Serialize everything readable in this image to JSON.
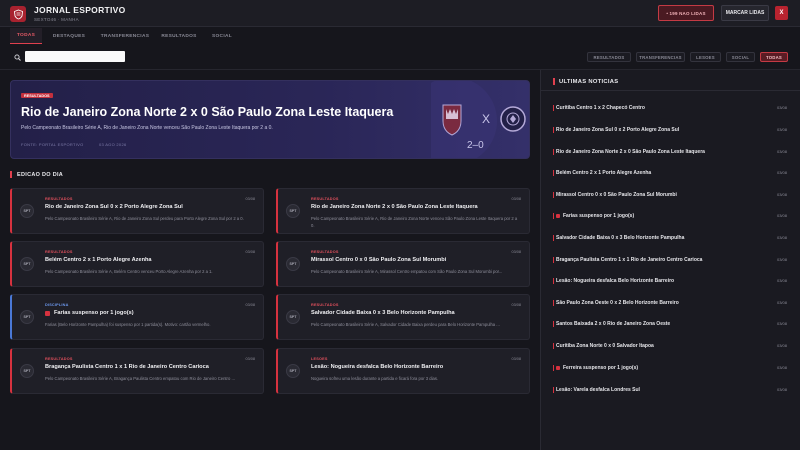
{
  "header": {
    "title": "JORNAL ESPORTIVO",
    "subtitle": "SEXTO46 · MANHA",
    "unread_label": "• 199 NAO LIDAS",
    "mark_read_label": "MARCAR LIDAS",
    "close_label": "X"
  },
  "tabs": [
    {
      "label": "TODAS",
      "active": true
    },
    {
      "label": "DESTAQUES",
      "active": false
    },
    {
      "label": "TRANSFERENCIAS",
      "active": false
    },
    {
      "label": "RESULTADOS",
      "active": false
    },
    {
      "label": "SOCIAL",
      "active": false
    }
  ],
  "search": {
    "value": "",
    "placeholder": ""
  },
  "filters": [
    {
      "label": "RESULTADOS",
      "active": false
    },
    {
      "label": "TRANSFERENCIAS",
      "active": false
    },
    {
      "label": "LESOES",
      "active": false
    },
    {
      "label": "SOCIAL",
      "active": false
    },
    {
      "label": "TODAS",
      "active": true
    }
  ],
  "hero": {
    "badge": "RESULTADOS",
    "title": "Rio de Janeiro Zona Norte 2 x 0 São Paulo Zona Leste Itaquera",
    "description": "Pelo Campeonato Brasileiro Série A, Rio de Janeiro Zona Norte venceu São Paulo Zona Leste Itaquera por 2 a 0.",
    "source": "FONTE: PORTAL ESPORTIVO",
    "date": "03 AGO 2026",
    "art_vs": "X",
    "art_score": "2–0"
  },
  "section": {
    "title": "EDICAO DO DIA"
  },
  "cards": [
    {
      "category": "RESULTADOS",
      "date": "03/08",
      "title": "Rio de Janeiro Zona Sul 0 x 2 Porto Alegre Zona Sul",
      "desc": "Pelo Campeonato Brasileiro Série A, Rio de Janeiro Zona Sul perdeu para Porto Alegre Zona Sul por 2 a 0.",
      "avatar": "SPT",
      "square": false,
      "color": "red"
    },
    {
      "category": "RESULTADOS",
      "date": "03/08",
      "title": "Rio de Janeiro Zona Norte 2 x 0 São Paulo Zona Leste Itaquera",
      "desc": "Pelo Campeonato Brasileiro Série A, Rio de Janeiro Zona Norte venceu São Paulo Zona Leste Itaquera por 2 a 0.",
      "avatar": "SPT",
      "square": false,
      "color": "red"
    },
    {
      "category": "RESULTADOS",
      "date": "03/08",
      "title": "Belém Centro 2 x 1 Porto Alegre Azenha",
      "desc": "Pelo Campeonato Brasileiro Série A, Belém Centro venceu Porto Alegre Azenha por 2 a 1.",
      "avatar": "SPT",
      "square": false,
      "color": "red"
    },
    {
      "category": "RESULTADOS",
      "date": "03/08",
      "title": "Mirassol Centro 0 x 0 São Paulo Zona Sul Morumbi",
      "desc": "Pelo Campeonato Brasileiro Série A, Mirassol Centro empatou com São Paulo Zona Sul Morumbi por...",
      "avatar": "SPT",
      "square": false,
      "color": "red"
    },
    {
      "category": "DISCIPLINA",
      "date": "03/08",
      "title": "Farias suspenso por 1 jogo(s)",
      "desc": "Farias (Belo Horizonte Pampulha) foi suspenso por 1 partida(s). Motivo: cartão vermelho.",
      "avatar": "SPT",
      "square": true,
      "color": "blue"
    },
    {
      "category": "RESULTADOS",
      "date": "03/08",
      "title": "Salvador Cidade Baixa 0 x 3 Belo Horizonte Pampulha",
      "desc": "Pelo Campeonato Brasileiro Série A, Salvador Cidade Baixa perdeu para Belo Horizonte Pampulha ...",
      "avatar": "SPT",
      "square": false,
      "color": "red"
    },
    {
      "category": "RESULTADOS",
      "date": "03/08",
      "title": "Bragança Paulista Centro 1 x 1 Rio de Janeiro Centro Carioca",
      "desc": "Pelo Campeonato Brasileiro Série A, Bragança Paulista Centro empatou com Rio de Janeiro Centro ...",
      "avatar": "SPT",
      "square": false,
      "color": "red"
    },
    {
      "category": "LESOES",
      "date": "03/08",
      "title": "Lesão: Nogueira desfalca Belo Horizonte Barreiro",
      "desc": "Nogueira sofreu uma lesão durante a partida e ficará fora por 3 dias.",
      "avatar": "SPT",
      "square": false,
      "color": "red"
    }
  ],
  "panel": {
    "title": "ULTIMAS NOTICIAS",
    "items": [
      {
        "title": "Curitiba Centro 1 x 2 Chapecó Centro",
        "date": "03/08",
        "square": false
      },
      {
        "title": "Rio de Janeiro Zona Sul 0 x 2 Porto Alegre Zona Sul",
        "date": "03/08",
        "square": false
      },
      {
        "title": "Rio de Janeiro Zona Norte 2 x 0 São Paulo Zona Leste Itaquera",
        "date": "03/08",
        "square": false
      },
      {
        "title": "Belém Centro 2 x 1 Porto Alegre Azenha",
        "date": "03/08",
        "square": false
      },
      {
        "title": "Mirassol Centro 0 x 0 São Paulo Zona Sul Morumbi",
        "date": "03/08",
        "square": false
      },
      {
        "title": "Farias suspenso por 1 jogo(s)",
        "date": "03/08",
        "square": true
      },
      {
        "title": "Salvador Cidade Baixa 0 x 3 Belo Horizonte Pampulha",
        "date": "03/08",
        "square": false
      },
      {
        "title": "Bragança Paulista Centro 1 x 1 Rio de Janeiro Centro Carioca",
        "date": "03/08",
        "square": false
      },
      {
        "title": "Lesão: Nogueira desfalca Belo Horizonte Barreiro",
        "date": "03/08",
        "square": false
      },
      {
        "title": "São Paulo Zona Oeste 0 x 2 Belo Horizonte Barreiro",
        "date": "03/08",
        "square": false
      },
      {
        "title": "Santos Baixada 2 x 0 Rio de Janeiro Zona Oeste",
        "date": "03/08",
        "square": false
      },
      {
        "title": "Curitiba Zona Norte 0 x 0 Salvador Itapoa",
        "date": "03/08",
        "square": false
      },
      {
        "title": "Ferreira suspenso por 1 jogo(s)",
        "date": "03/08",
        "square": true
      },
      {
        "title": "Lesão: Varela desfalca Londres Sul",
        "date": "03/08",
        "square": false
      }
    ]
  },
  "colors": {
    "accent": "#e0404e",
    "background": "#16161c",
    "hero": "#2a2657",
    "blue": "#4a78d6"
  }
}
